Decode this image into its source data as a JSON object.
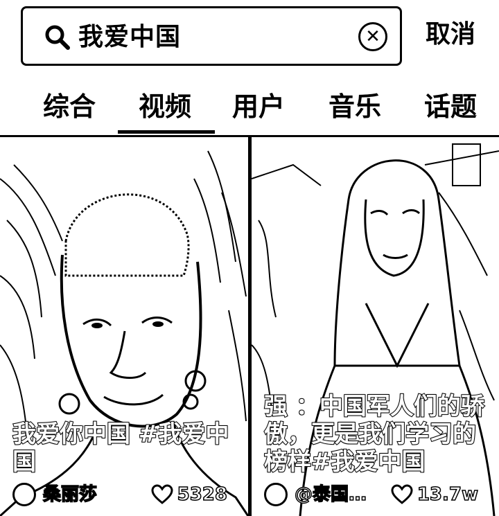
{
  "search": {
    "query": "我爱中国",
    "clear_icon": "✕",
    "cancel_label": "取消"
  },
  "tabs": [
    {
      "label": "综合",
      "active": false
    },
    {
      "label": "视频",
      "active": true
    },
    {
      "label": "用户",
      "active": false
    },
    {
      "label": "音乐",
      "active": false
    },
    {
      "label": "话题",
      "active": false
    }
  ],
  "videos": [
    {
      "caption": "我爱你中国 #我爱中国",
      "author": "桑丽莎",
      "likes": "5328"
    },
    {
      "caption": "强 ：中国军人们的骄傲，更是我们学习的榜样#我爱中国",
      "author": "@泰国…",
      "likes": "13.7w"
    }
  ],
  "icons": {
    "search": "search-icon",
    "clear": "clear-icon",
    "like": "heart-icon"
  }
}
